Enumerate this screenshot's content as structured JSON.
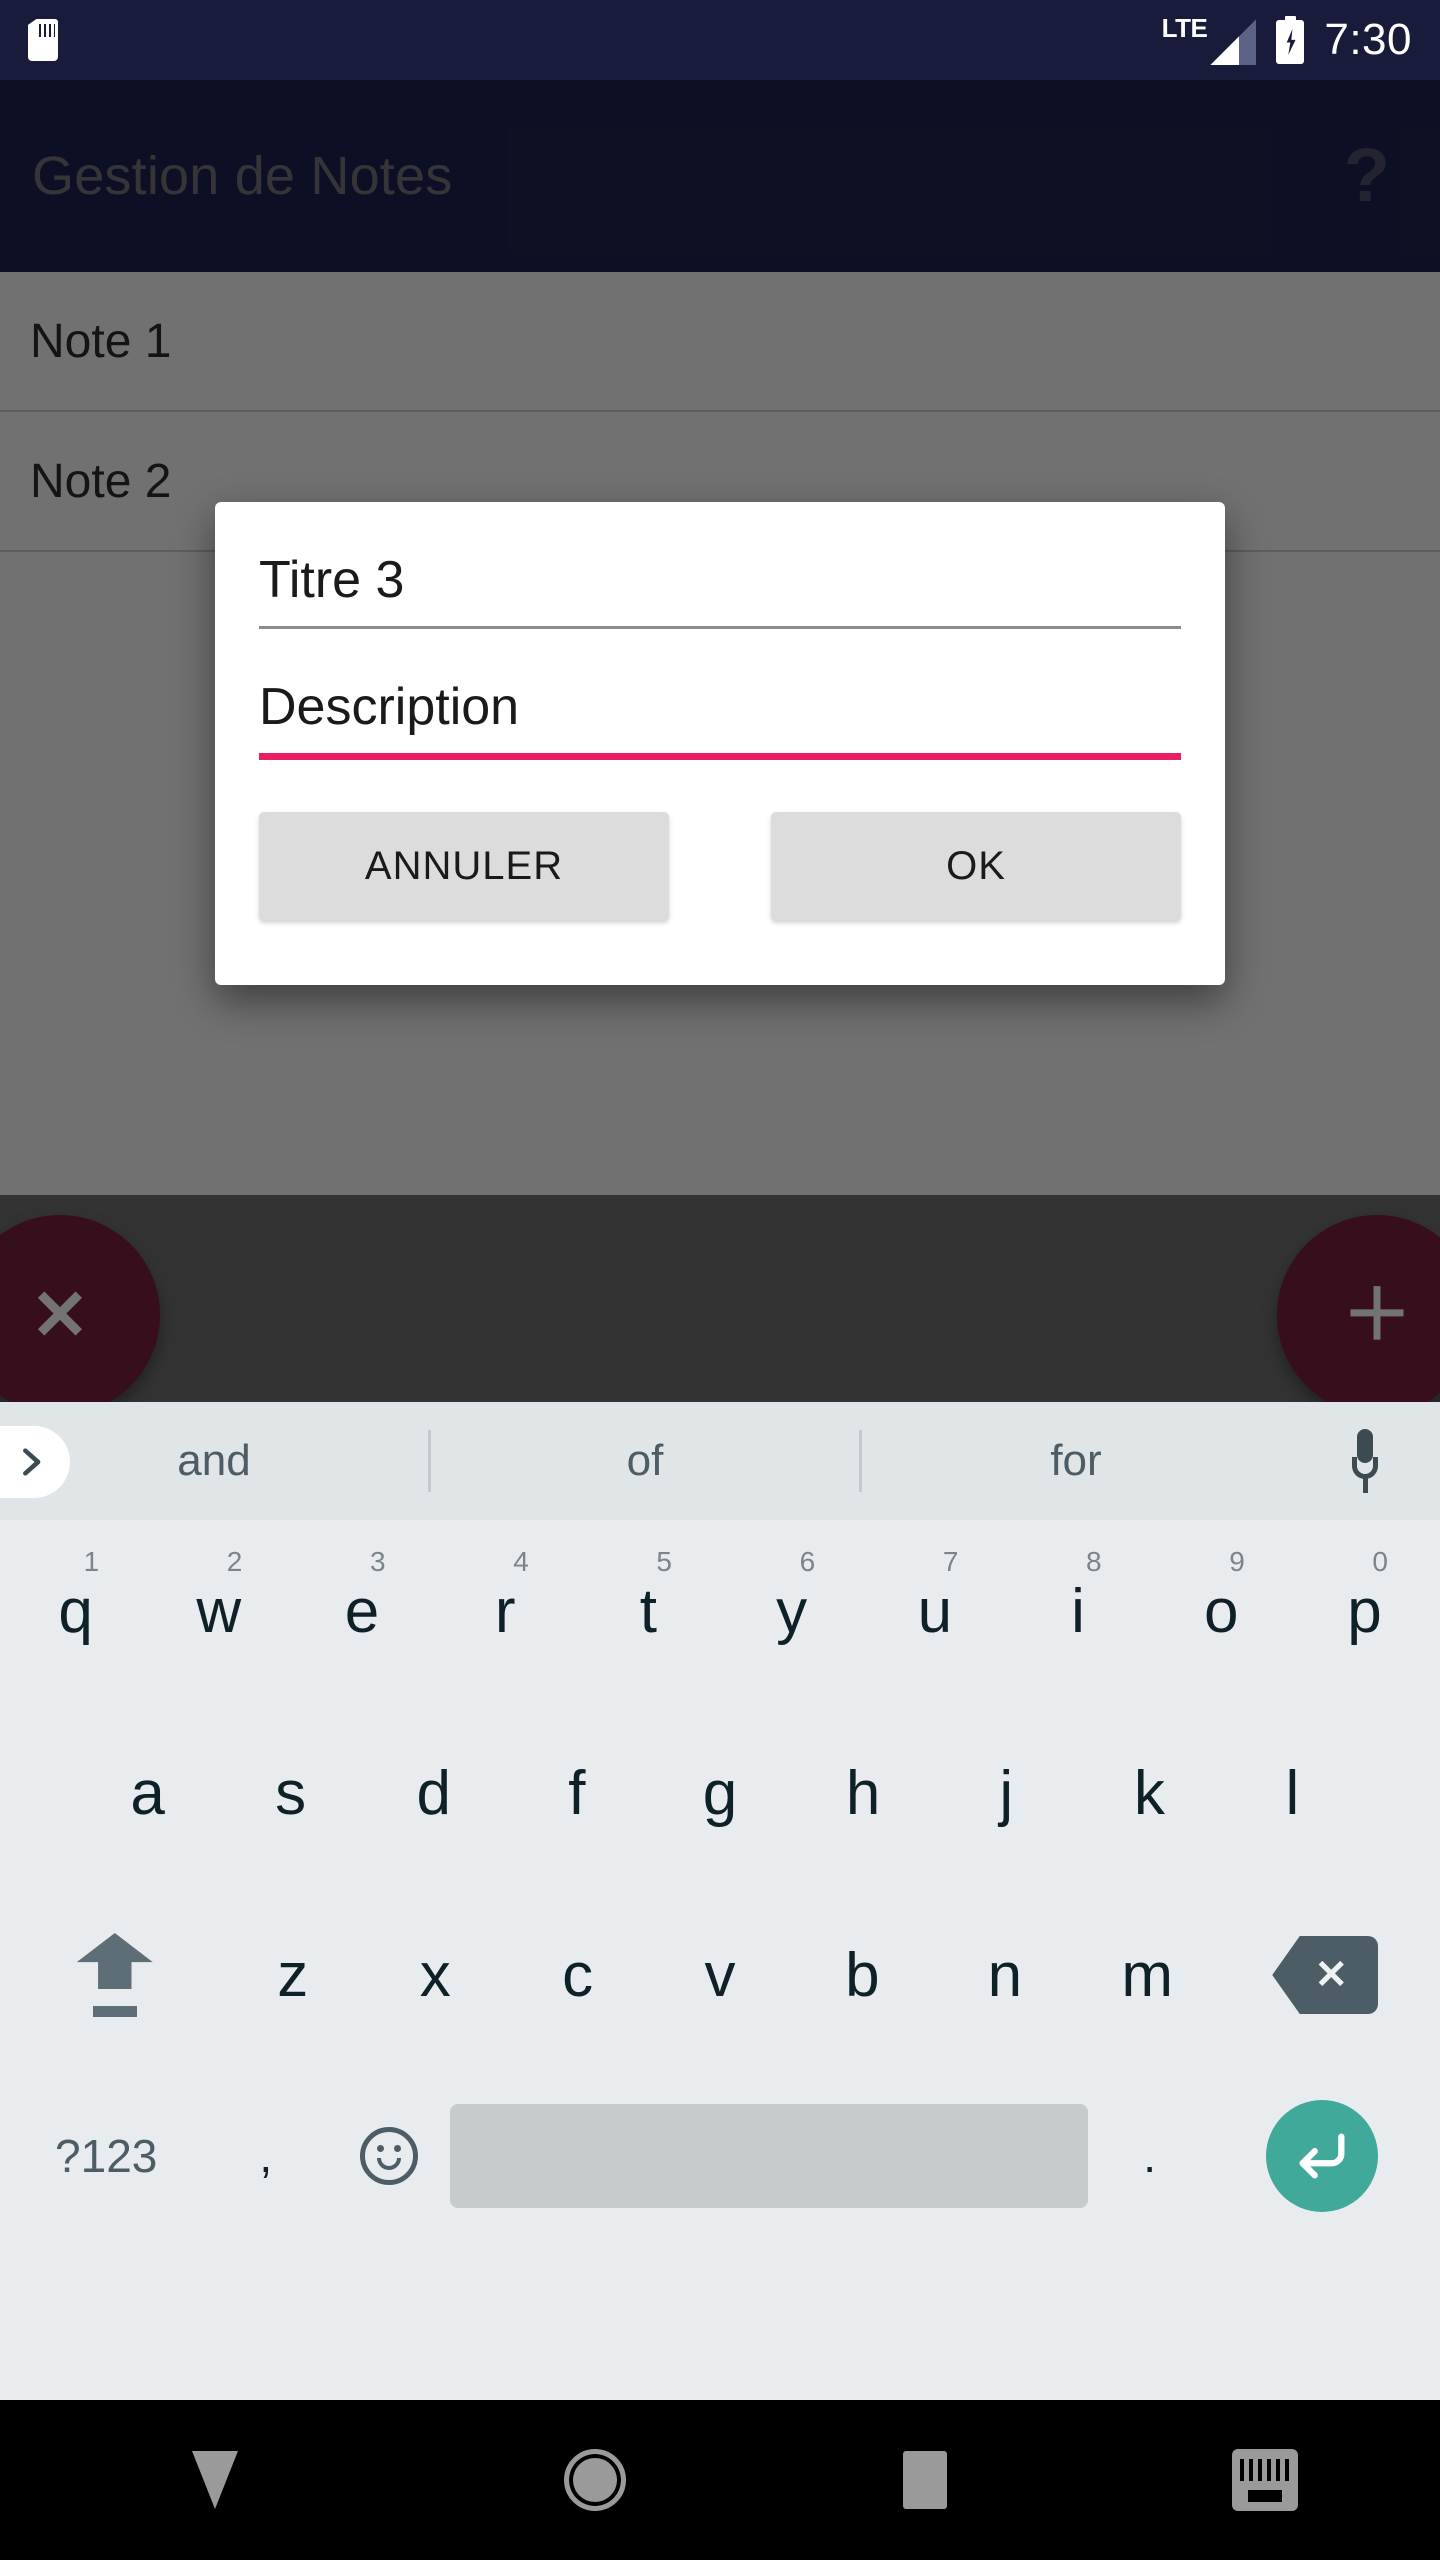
{
  "status_bar": {
    "sd_card_icon": "sd-card-icon",
    "network_type": "LTE",
    "signal_icon": "signal-bars-icon",
    "battery_icon": "battery-charging-icon",
    "time": "7:30"
  },
  "app_bar": {
    "title": "Gestion de Notes",
    "help_label": "?"
  },
  "notes": [
    {
      "title": "Note 1"
    },
    {
      "title": "Note 2"
    }
  ],
  "fabs": {
    "delete_glyph": "✕",
    "add_glyph": "＋"
  },
  "dialog": {
    "title_field": {
      "value": "Titre 3",
      "placeholder": "Titre"
    },
    "description_field": {
      "value": "Description",
      "placeholder": "Description"
    },
    "cancel_label": "ANNULER",
    "ok_label": "OK",
    "focused_underline_color": "#e91e63",
    "unfocused_underline_color": "#8c8c8c"
  },
  "keyboard": {
    "suggestions": [
      "and",
      "of",
      "for"
    ],
    "expand_icon": "chevron-right-icon",
    "mic_icon": "microphone-icon",
    "row1": [
      {
        "letter": "q",
        "number": "1"
      },
      {
        "letter": "w",
        "number": "2"
      },
      {
        "letter": "e",
        "number": "3"
      },
      {
        "letter": "r",
        "number": "4"
      },
      {
        "letter": "t",
        "number": "5"
      },
      {
        "letter": "y",
        "number": "6"
      },
      {
        "letter": "u",
        "number": "7"
      },
      {
        "letter": "i",
        "number": "8"
      },
      {
        "letter": "o",
        "number": "9"
      },
      {
        "letter": "p",
        "number": "0"
      }
    ],
    "row2": [
      "a",
      "s",
      "d",
      "f",
      "g",
      "h",
      "j",
      "k",
      "l"
    ],
    "row3": [
      "z",
      "x",
      "c",
      "v",
      "b",
      "n",
      "m"
    ],
    "shift_icon": "shift-icon",
    "backspace_icon": "backspace-icon",
    "symbols_label": "?123",
    "comma_label": ",",
    "emoji_icon": "emoji-icon",
    "period_label": ".",
    "enter_icon": "enter-icon",
    "enter_color": "#41a99a"
  },
  "nav_bar": {
    "back_icon": "back-triangle-icon",
    "home_icon": "home-circle-icon",
    "recents_icon": "recents-square-icon",
    "keyboard_switch_icon": "keyboard-switcher-icon"
  }
}
